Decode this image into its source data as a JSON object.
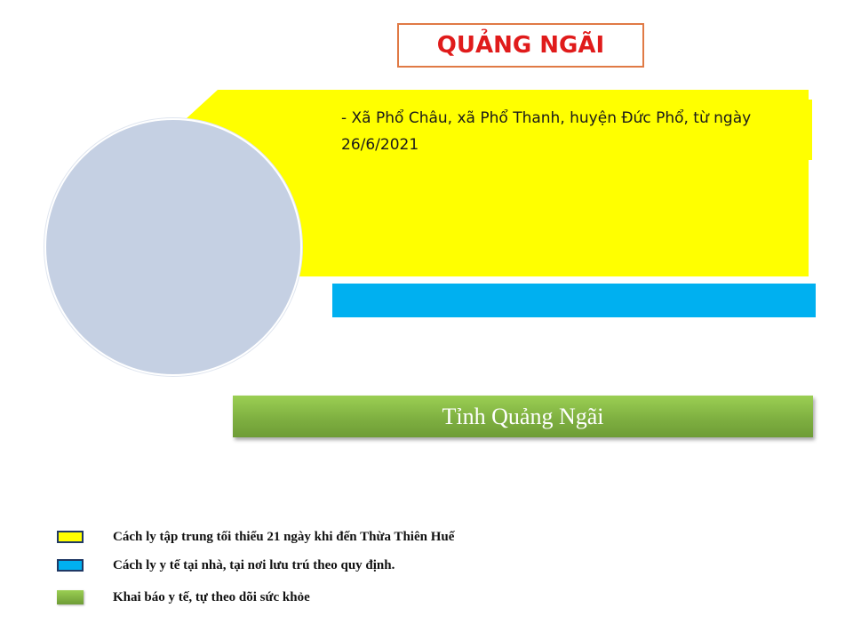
{
  "header": {
    "title": "QUẢNG NGÃI"
  },
  "region_note": {
    "text": "- Xã Phổ Châu, xã Phổ Thanh, huyện Đức Phổ, từ ngày 26/6/2021"
  },
  "province_bar": {
    "label": "Tỉnh Quảng Ngãi"
  },
  "legend": {
    "items": [
      {
        "label": "Cách ly tập trung tối thiểu 21 ngày khi đến Thừa Thiên Huế",
        "color": "#ffff00"
      },
      {
        "label": "Cách ly y tế tại nhà, tại nơi lưu trú theo quy định.",
        "color": "#00b0f0"
      },
      {
        "label": "Khai báo y tế, tự theo dõi sức khỏe",
        "color": "#7fb041"
      }
    ]
  }
}
